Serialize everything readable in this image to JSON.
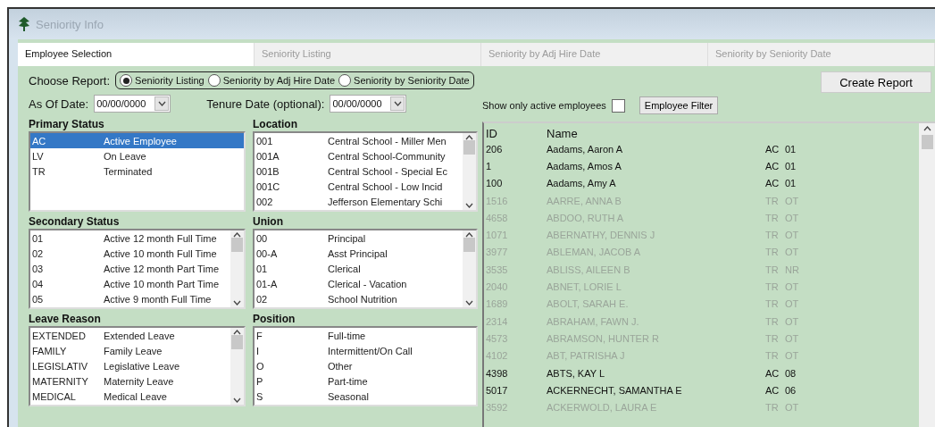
{
  "window": {
    "title": "Seniority Info"
  },
  "tabs": [
    {
      "label": "Employee Selection",
      "selected": true
    },
    {
      "label": "Seniority Listing",
      "selected": false
    },
    {
      "label": "Seniority by Adj Hire Date",
      "selected": false
    },
    {
      "label": "Seniority by Seniority Date",
      "selected": false
    }
  ],
  "report": {
    "label": "Choose Report:",
    "options": [
      {
        "label": "Seniority Listing",
        "selected": true
      },
      {
        "label": "Seniority by Adj Hire Date",
        "selected": false
      },
      {
        "label": "Seniority by Seniority Date",
        "selected": false
      }
    ],
    "create_button": "Create Report"
  },
  "as_of_date": {
    "label": "As Of Date:",
    "value": "00/00/0000"
  },
  "tenure_date": {
    "label": "Tenure Date (optional):",
    "value": "00/00/0000"
  },
  "active_only": {
    "label": "Show only active employees",
    "checked": false
  },
  "filter_button": "Employee Filter",
  "lists": [
    {
      "title": "Primary Status",
      "scrollable": false,
      "items": [
        {
          "code": "AC",
          "name": "Active Employee",
          "selected": true
        },
        {
          "code": "LV",
          "name": "On Leave",
          "selected": false
        },
        {
          "code": "TR",
          "name": "Terminated",
          "selected": false
        }
      ]
    },
    {
      "title": "Location",
      "scrollable": true,
      "items": [
        {
          "code": "001",
          "name": "Central School - Miller Men",
          "selected": false
        },
        {
          "code": "001A",
          "name": "Central School-Community",
          "selected": false
        },
        {
          "code": "001B",
          "name": "Central School - Special Ec",
          "selected": false
        },
        {
          "code": "001C",
          "name": "Central School - Low Incid",
          "selected": false
        },
        {
          "code": "002",
          "name": "Jefferson Elementary Schi",
          "selected": false
        }
      ]
    },
    {
      "title": "Secondary Status",
      "scrollable": true,
      "items": [
        {
          "code": "01",
          "name": "Active 12 month Full Time",
          "selected": false
        },
        {
          "code": "02",
          "name": "Active 10 month Full Time",
          "selected": false
        },
        {
          "code": "03",
          "name": "Active 12 month Part Time",
          "selected": false
        },
        {
          "code": "04",
          "name": "Active 10 month Part Time",
          "selected": false
        },
        {
          "code": "05",
          "name": "Active 9 month Full Time",
          "selected": false
        }
      ]
    },
    {
      "title": "Union",
      "scrollable": true,
      "items": [
        {
          "code": "00",
          "name": "Principal",
          "selected": false
        },
        {
          "code": "00-A",
          "name": "Asst Principal",
          "selected": false
        },
        {
          "code": "01",
          "name": "Clerical",
          "selected": false
        },
        {
          "code": "01-A",
          "name": "Clerical - Vacation",
          "selected": false
        },
        {
          "code": "02",
          "name": "School Nutrition",
          "selected": false
        }
      ]
    },
    {
      "title": "Leave Reason",
      "scrollable": true,
      "items": [
        {
          "code": "EXTENDED",
          "name": "Extended Leave",
          "selected": false
        },
        {
          "code": "FAMILY",
          "name": "Family Leave",
          "selected": false
        },
        {
          "code": "LEGISLATIV",
          "name": "Legislative Leave",
          "selected": false
        },
        {
          "code": "MATERNITY",
          "name": "Maternity Leave",
          "selected": false
        },
        {
          "code": "MEDICAL",
          "name": "Medical Leave",
          "selected": false
        }
      ]
    },
    {
      "title": "Position",
      "scrollable": false,
      "items": [
        {
          "code": "F",
          "name": "Full-time",
          "selected": false
        },
        {
          "code": "I",
          "name": "Intermittent/On Call",
          "selected": false
        },
        {
          "code": "O",
          "name": "Other",
          "selected": false
        },
        {
          "code": "P",
          "name": "Part-time",
          "selected": false
        },
        {
          "code": "S",
          "name": "Seasonal",
          "selected": false
        }
      ]
    }
  ],
  "employees": {
    "columns": [
      "ID",
      "Name"
    ],
    "rows": [
      {
        "id": "206",
        "name": "Aadams, Aaron A",
        "status": "AC",
        "code": "01",
        "active": true
      },
      {
        "id": "1",
        "name": "Aadams, Amos A",
        "status": "AC",
        "code": "01",
        "active": true
      },
      {
        "id": "100",
        "name": "Aadams, Amy A",
        "status": "AC",
        "code": "01",
        "active": true
      },
      {
        "id": "1516",
        "name": "AARRE, ANNA B",
        "status": "TR",
        "code": "OT",
        "active": false
      },
      {
        "id": "4658",
        "name": "ABDOO, RUTH A",
        "status": "TR",
        "code": "OT",
        "active": false
      },
      {
        "id": "1071",
        "name": "ABERNATHY, DENNIS J",
        "status": "TR",
        "code": "OT",
        "active": false
      },
      {
        "id": "3977",
        "name": "ABLEMAN, JACOB A",
        "status": "TR",
        "code": "OT",
        "active": false
      },
      {
        "id": "3535",
        "name": "ABLISS, AILEEN B",
        "status": "TR",
        "code": "NR",
        "active": false
      },
      {
        "id": "2040",
        "name": "ABNET, LORIE L",
        "status": "TR",
        "code": "OT",
        "active": false
      },
      {
        "id": "1689",
        "name": "ABOLT, SARAH E.",
        "status": "TR",
        "code": "OT",
        "active": false
      },
      {
        "id": "2314",
        "name": "ABRAHAM, FAWN J.",
        "status": "TR",
        "code": "OT",
        "active": false
      },
      {
        "id": "4573",
        "name": "ABRAMSON, HUNTER R",
        "status": "TR",
        "code": "OT",
        "active": false
      },
      {
        "id": "4102",
        "name": "ABT, PATRISHA J",
        "status": "TR",
        "code": "OT",
        "active": false
      },
      {
        "id": "4398",
        "name": "ABTS, KAY L",
        "status": "AC",
        "code": "08",
        "active": true
      },
      {
        "id": "5017",
        "name": "ACKERNECHT, SAMANTHA E",
        "status": "AC",
        "code": "06",
        "active": true
      },
      {
        "id": "3592",
        "name": "ACKERWOLD, LAURA E",
        "status": "TR",
        "code": "OT",
        "active": false
      }
    ]
  }
}
